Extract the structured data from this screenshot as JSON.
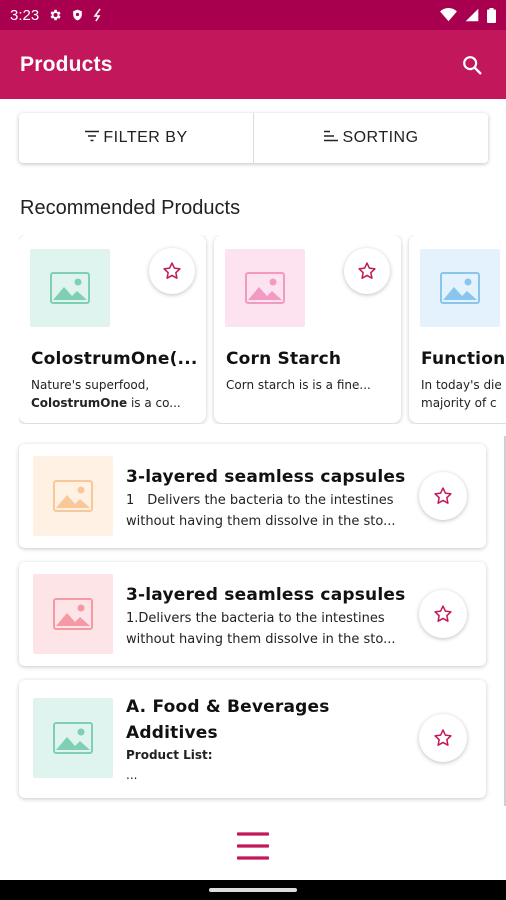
{
  "status_bar": {
    "time": "3:23",
    "icons": [
      "gear-icon",
      "shield-icon",
      "sync-icon",
      "wifi-icon",
      "signal-icon",
      "battery-icon"
    ]
  },
  "app_bar": {
    "title": "Products",
    "search_icon": "search-icon"
  },
  "filter_bar": {
    "filter_label": "FILTER BY",
    "sort_label": "SORTING"
  },
  "recommended": {
    "heading": "Recommended Products",
    "items": [
      {
        "name": "ColostrumOne(...",
        "line1": "Nature's superfood,",
        "line2_bold": "ColostrumOne",
        "line2_rest": " is a co...",
        "thumb_bg": "#e0f4ef",
        "thumb_fg": "#7fcfb4"
      },
      {
        "name": "Corn Starch",
        "line1": "",
        "line2_bold": "",
        "line2_rest": "Corn starch is is a fine...",
        "thumb_bg": "#fde3ef",
        "thumb_fg": "#f39ac2"
      },
      {
        "name": "Functiona",
        "line1": "In today's die",
        "line2_bold": "",
        "line2_rest": "majority of c",
        "thumb_bg": "#e4f2fd",
        "thumb_fg": "#8ac5ee"
      }
    ]
  },
  "products": [
    {
      "name_line1": "3-layered seamless capsules",
      "name_line2": "",
      "desc_line1": "1　Delivers the bacteria to the intestines",
      "desc_line2": "without having them dissolve in the sto...",
      "thumb_bg": "#fff1e3",
      "thumb_fg": "#f8c898"
    },
    {
      "name_line1": "3-layered seamless capsules",
      "name_line2": "",
      "desc_line1": "1.Delivers the bacteria to the intestines",
      "desc_line2": "without having them dissolve in the sto...",
      "thumb_bg": "#fde4e6",
      "thumb_fg": "#f59aa4"
    },
    {
      "name_line1": "A. Food & Beverages",
      "name_line2": "Additives",
      "desc_line1": "Product List:",
      "desc_line2": "...",
      "thumb_bg": "#e0f4ef",
      "thumb_fg": "#7fcfb4"
    }
  ],
  "colors": {
    "primary": "#c2185b",
    "status_bar": "#a8004f",
    "star": "#c2185b"
  }
}
